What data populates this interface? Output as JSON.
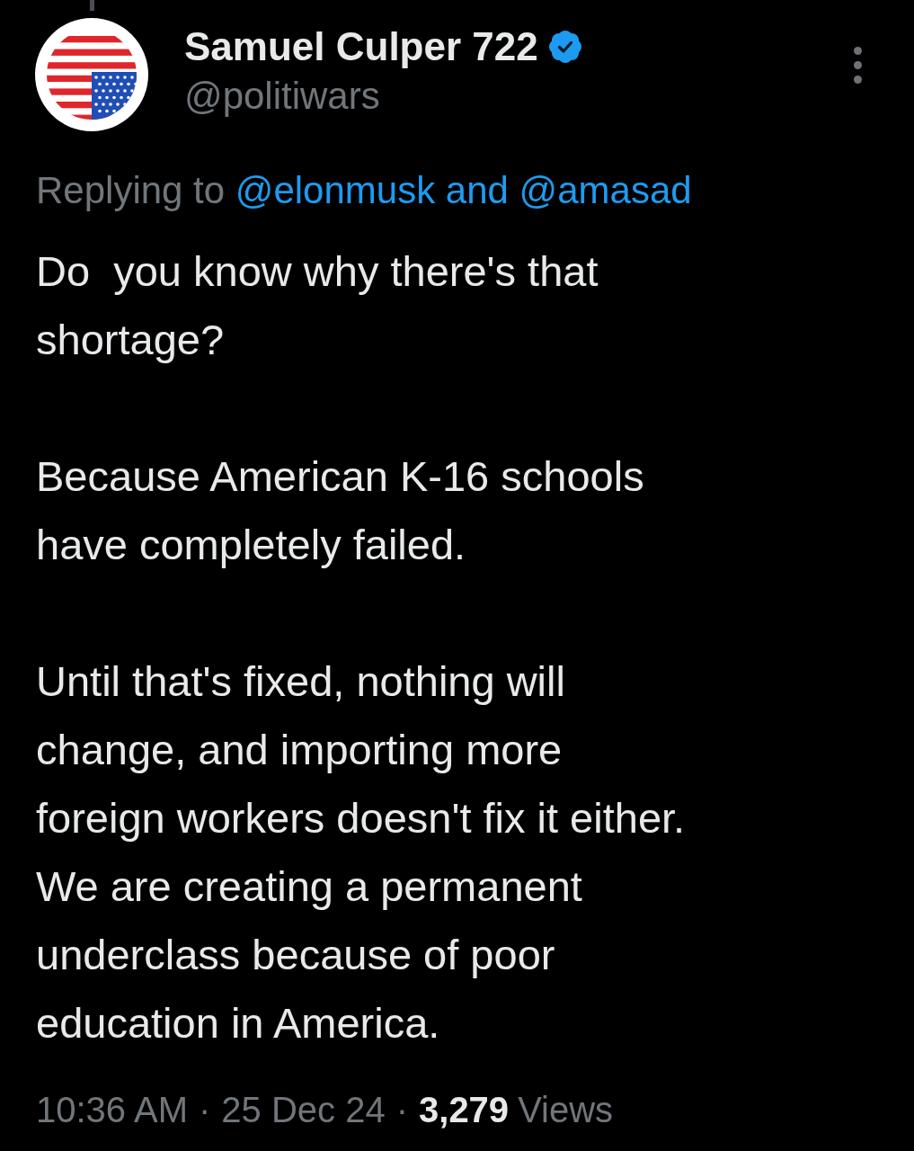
{
  "author": {
    "name": "Samuel Culper 722",
    "verified": true,
    "handle": "@politiwars"
  },
  "reply_context": {
    "prefix": "Replying to",
    "mentions": "@elonmusk and @amasad"
  },
  "body": {
    "paragraphs": [
      "Do  you know why there's that\nshortage?",
      "Because American K-16 schools\nhave completely failed.",
      "Until that's fixed, nothing will\nchange, and importing more\nforeign workers doesn't fix it either.\nWe are creating a permanent\nunderclass because of poor\neducation in America."
    ]
  },
  "meta": {
    "time": "10:36 AM",
    "separator_1": "·",
    "date": "25 Dec 24",
    "separator_2": "·",
    "views_count": "3,279",
    "views_label": "Views"
  }
}
